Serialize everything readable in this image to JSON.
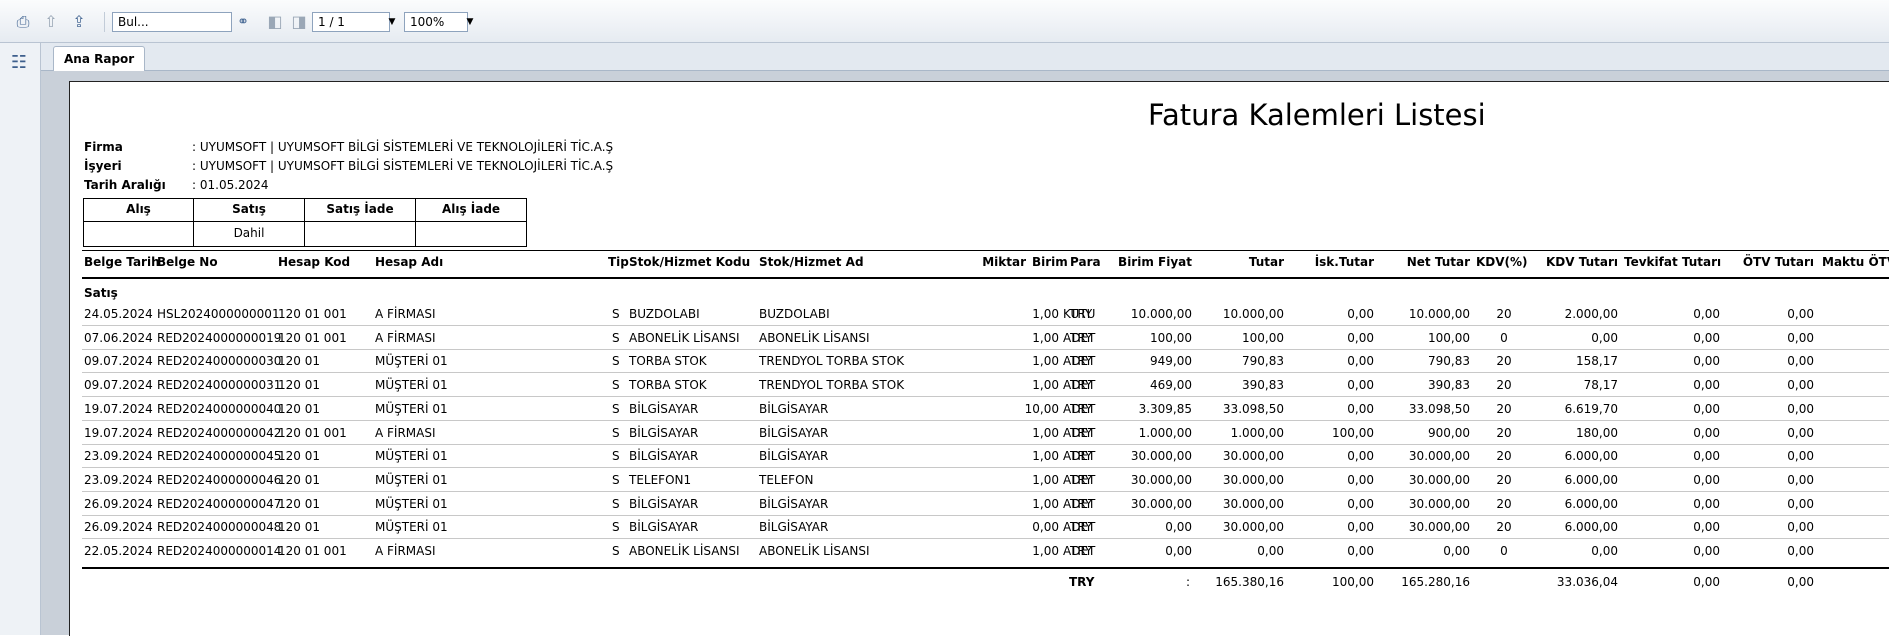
{
  "toolbar": {
    "search_placeholder": "Bul...",
    "page_value": "1 / 1",
    "zoom_value": "100%"
  },
  "tabs": [
    {
      "label": "Ana Rapor"
    }
  ],
  "report": {
    "title": "Fatura Kalemleri Listesi",
    "info": [
      {
        "label": "Firma",
        "value": ":  UYUMSOFT | UYUMSOFT BİLGİ SİSTEMLERİ VE TEKNOLOJİLERİ TİC.A.Ş"
      },
      {
        "label": "İşyeri",
        "value": ":  UYUMSOFT | UYUMSOFT BİLGİ SİSTEMLERİ VE TEKNOLOJİLERİ TİC.A.Ş"
      },
      {
        "label": "Tarih Aralığı",
        "value": ":  01.05.2024"
      }
    ],
    "filter_box": {
      "headers": [
        "Alış",
        "Satış",
        "Satış İade",
        "Alış İade"
      ],
      "values": [
        "",
        "Dahil",
        "",
        ""
      ]
    },
    "columns": [
      "Belge Tarih",
      "Belge No",
      "Hesap Kod",
      "Hesap Adı",
      "Tip",
      "Stok/Hizmet Kodu",
      "Stok/Hizmet Ad",
      "Miktar",
      "Birim",
      "Para",
      "Birim Fiyat",
      "Tutar",
      "İsk.Tutar",
      "Net Tutar",
      "KDV(%)",
      "KDV Tutarı",
      "Tevkifat Tutarı",
      "ÖTV Tutarı",
      "Maktu ÖTV"
    ],
    "group_label": "Satış",
    "rows": [
      [
        "24.05.2024",
        "HSL2024000000001",
        "120 01 001",
        "A FİRMASI",
        "S",
        "BUZDOLABI",
        "BUZDOLABI",
        "1,00",
        "KUTU",
        "TRY",
        "10.000,00",
        "10.000,00",
        "0,00",
        "10.000,00",
        "20",
        "2.000,00",
        "0,00",
        "0,00"
      ],
      [
        "07.06.2024",
        "RED2024000000019",
        "120 01 001",
        "A FİRMASI",
        "S",
        "ABONELİK LİSANSI",
        "ABONELİK LİSANSI",
        "1,00",
        "ADET",
        "TRY",
        "100,00",
        "100,00",
        "0,00",
        "100,00",
        "0",
        "0,00",
        "0,00",
        "0,00"
      ],
      [
        "09.07.2024",
        "RED2024000000030",
        "120 01",
        "MÜŞTERİ 01",
        "S",
        "TORBA STOK",
        "TRENDYOL TORBA STOK",
        "1,00",
        "ADET",
        "TRY",
        "949,00",
        "790,83",
        "0,00",
        "790,83",
        "20",
        "158,17",
        "0,00",
        "0,00"
      ],
      [
        "09.07.2024",
        "RED2024000000031",
        "120 01",
        "MÜŞTERİ 01",
        "S",
        "TORBA STOK",
        "TRENDYOL TORBA STOK",
        "1,00",
        "ADET",
        "TRY",
        "469,00",
        "390,83",
        "0,00",
        "390,83",
        "20",
        "78,17",
        "0,00",
        "0,00"
      ],
      [
        "19.07.2024",
        "RED2024000000040",
        "120 01",
        "MÜŞTERİ 01",
        "S",
        "BİLGİSAYAR",
        "BİLGİSAYAR",
        "10,00",
        "ADET",
        "TRY",
        "3.309,85",
        "33.098,50",
        "0,00",
        "33.098,50",
        "20",
        "6.619,70",
        "0,00",
        "0,00"
      ],
      [
        "19.07.2024",
        "RED2024000000042",
        "120 01 001",
        "A FİRMASI",
        "S",
        "BİLGİSAYAR",
        "BİLGİSAYAR",
        "1,00",
        "ADET",
        "TRY",
        "1.000,00",
        "1.000,00",
        "100,00",
        "900,00",
        "20",
        "180,00",
        "0,00",
        "0,00"
      ],
      [
        "23.09.2024",
        "RED2024000000045",
        "120 01",
        "MÜŞTERİ 01",
        "S",
        "BİLGİSAYAR",
        "BİLGİSAYAR",
        "1,00",
        "ADET",
        "TRY",
        "30.000,00",
        "30.000,00",
        "0,00",
        "30.000,00",
        "20",
        "6.000,00",
        "0,00",
        "0,00"
      ],
      [
        "23.09.2024",
        "RED2024000000046",
        "120 01",
        "MÜŞTERİ 01",
        "S",
        "TELEFON1",
        "TELEFON",
        "1,00",
        "ADET",
        "TRY",
        "30.000,00",
        "30.000,00",
        "0,00",
        "30.000,00",
        "20",
        "6.000,00",
        "0,00",
        "0,00"
      ],
      [
        "26.09.2024",
        "RED2024000000047",
        "120 01",
        "MÜŞTERİ 01",
        "S",
        "BİLGİSAYAR",
        "BİLGİSAYAR",
        "1,00",
        "ADET",
        "TRY",
        "30.000,00",
        "30.000,00",
        "0,00",
        "30.000,00",
        "20",
        "6.000,00",
        "0,00",
        "0,00"
      ],
      [
        "26.09.2024",
        "RED2024000000048",
        "120 01",
        "MÜŞTERİ 01",
        "S",
        "BİLGİSAYAR",
        "BİLGİSAYAR",
        "0,00",
        "ADET",
        "TRY",
        "0,00",
        "30.000,00",
        "0,00",
        "30.000,00",
        "20",
        "6.000,00",
        "0,00",
        "0,00"
      ],
      [
        "22.05.2024",
        "RED2024000000014",
        "120 01 001",
        "A FİRMASI",
        "S",
        "ABONELİK LİSANSI",
        "ABONELİK LİSANSI",
        "1,00",
        "ADET",
        "TRY",
        "0,00",
        "0,00",
        "0,00",
        "0,00",
        "0",
        "0,00",
        "0,00",
        "0,00"
      ]
    ],
    "totals": {
      "currency": "TRY",
      "colon": ":",
      "tutar": "165.380,16",
      "isk": "100,00",
      "net": "165.280,16",
      "kdv": "33.036,04",
      "tevkifat": "0,00",
      "otv": "0,00"
    }
  }
}
